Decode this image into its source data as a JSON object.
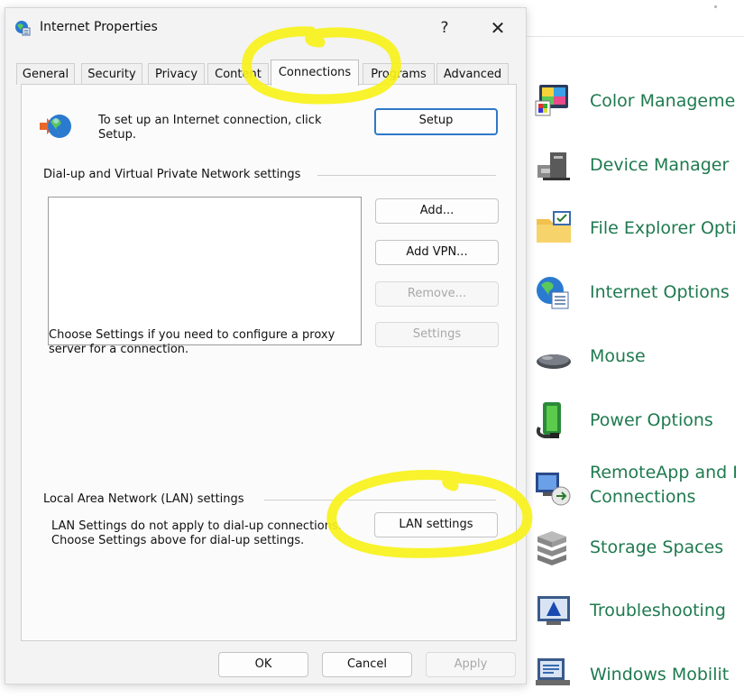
{
  "dialog": {
    "title": "Internet Properties",
    "help_label": "?",
    "close_label": "✕",
    "tabs": [
      {
        "label": "General"
      },
      {
        "label": "Security"
      },
      {
        "label": "Privacy"
      },
      {
        "label": "Content"
      },
      {
        "label": "Connections",
        "active": true
      },
      {
        "label": "Programs"
      },
      {
        "label": "Advanced"
      }
    ],
    "setup": {
      "text": "To set up an Internet connection, click Setup.",
      "button": "Setup"
    },
    "dialup": {
      "group_label": "Dial-up and Virtual Private Network settings",
      "add_button": "Add...",
      "add_vpn_button": "Add VPN...",
      "remove_button": "Remove...",
      "settings_button": "Settings",
      "proxy_text": "Choose Settings if you need to configure a proxy server for a connection."
    },
    "lan": {
      "group_label": "Local Area Network (LAN) settings",
      "text": "LAN Settings do not apply to dial-up connections. Choose Settings above for dial-up settings.",
      "button": "LAN settings"
    },
    "footer": {
      "ok": "OK",
      "cancel": "Cancel",
      "apply": "Apply"
    }
  },
  "control_panel": {
    "items": [
      {
        "label": "Color Manageme",
        "icon": "color-management-icon"
      },
      {
        "label": "Device Manager",
        "icon": "device-manager-icon"
      },
      {
        "label": "File Explorer Opti",
        "icon": "file-explorer-options-icon"
      },
      {
        "label": "Internet Options",
        "icon": "internet-options-icon"
      },
      {
        "label": "Mouse",
        "icon": "mouse-icon"
      },
      {
        "label": "Power Options",
        "icon": "power-options-icon"
      },
      {
        "label": "RemoteApp and I",
        "label2": "Connections",
        "icon": "remoteapp-icon"
      },
      {
        "label": "Storage Spaces",
        "icon": "storage-spaces-icon"
      },
      {
        "label": "Troubleshooting",
        "icon": "troubleshooting-icon"
      },
      {
        "label": "Windows Mobilit",
        "icon": "windows-mobility-icon"
      }
    ]
  },
  "colors": {
    "accent": "#2f78c8",
    "link_green": "#1f7a4f",
    "highlighter": "#f7f21a"
  }
}
